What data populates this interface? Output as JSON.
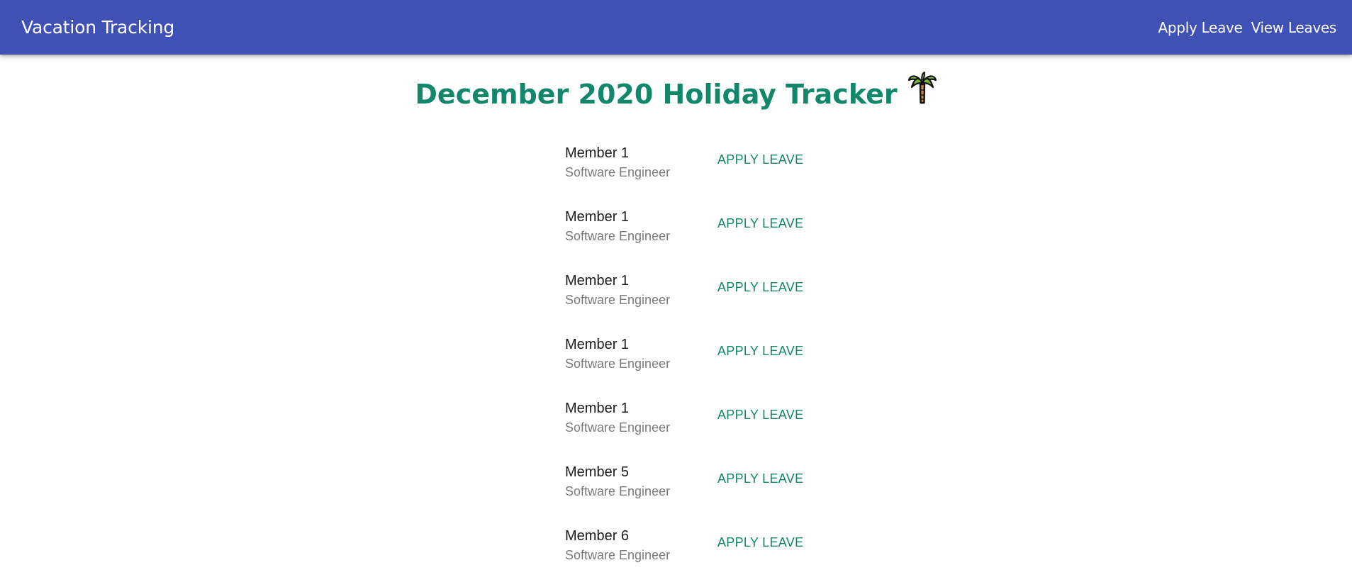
{
  "appbar": {
    "title": "Vacation Tracking",
    "background": "#3f51b5",
    "nav": [
      {
        "label": "Apply Leave"
      },
      {
        "label": "View Leaves"
      }
    ]
  },
  "page": {
    "title": "December 2020 Holiday Tracker",
    "title_icon": "palm-tree-icon",
    "accent": "#12876a"
  },
  "members": [
    {
      "name": "Member 1",
      "role": "Software Engineer",
      "action": "APPLY LEAVE"
    },
    {
      "name": "Member 1",
      "role": "Software Engineer",
      "action": "APPLY LEAVE"
    },
    {
      "name": "Member 1",
      "role": "Software Engineer",
      "action": "APPLY LEAVE"
    },
    {
      "name": "Member 1",
      "role": "Software Engineer",
      "action": "APPLY LEAVE"
    },
    {
      "name": "Member 1",
      "role": "Software Engineer",
      "action": "APPLY LEAVE"
    },
    {
      "name": "Member 5",
      "role": "Software Engineer",
      "action": "APPLY LEAVE"
    },
    {
      "name": "Member 6",
      "role": "Software Engineer",
      "action": "APPLY LEAVE"
    }
  ]
}
